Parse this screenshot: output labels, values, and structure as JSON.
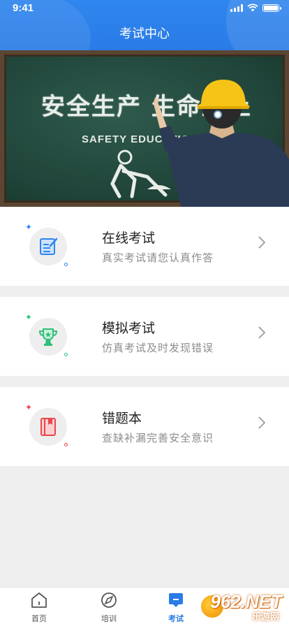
{
  "status": {
    "time": "9:41"
  },
  "header": {
    "title": "考试中心"
  },
  "banner": {
    "board_text": "安全生产 生命至上",
    "board_en": "SAFETY EDUCATION"
  },
  "cards": [
    {
      "title": "在线考试",
      "subtitle": "真实考试请您认真作答",
      "icon": "exam-sheet-icon",
      "accent": "#2f86ee"
    },
    {
      "title": "模拟考试",
      "subtitle": "仿真考试及时发现错误",
      "icon": "trophy-icon",
      "accent": "#2fbf7a"
    },
    {
      "title": "错题本",
      "subtitle": "查缺补漏完善安全意识",
      "icon": "error-book-icon",
      "accent": "#e8474c"
    }
  ],
  "tabs": [
    {
      "label": "首页",
      "icon": "home-icon"
    },
    {
      "label": "培训",
      "icon": "compass-icon"
    },
    {
      "label": "考试",
      "icon": "exam-icon",
      "active": true
    }
  ],
  "watermark": {
    "number": "962.NET",
    "site": "乐游网"
  },
  "colors": {
    "primary": "#2a7be6",
    "background": "#efefef"
  }
}
